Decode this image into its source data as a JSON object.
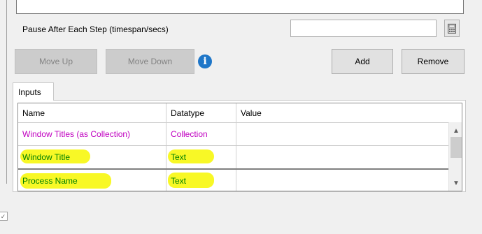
{
  "pause": {
    "label": "Pause After Each Step (timespan/secs)",
    "value": ""
  },
  "buttons": {
    "move_up": "Move Up",
    "move_down": "Move Down",
    "add": "Add",
    "remove": "Remove"
  },
  "tabs": [
    {
      "label": "Inputs",
      "active": true
    }
  ],
  "grid": {
    "columns": [
      "Name",
      "Datatype",
      "Value"
    ],
    "rows": [
      {
        "name": "Window Titles (as Collection)",
        "datatype": "Collection",
        "value": "",
        "color": "#c000c0",
        "highlighted": false
      },
      {
        "name": "Window Title",
        "datatype": "Text",
        "value": "",
        "color": "#008000",
        "highlighted": true
      },
      {
        "name": "Process Name",
        "datatype": "Text",
        "value": "",
        "color": "#008000",
        "highlighted": true
      }
    ]
  },
  "colors": {
    "highlight": "#f7f700",
    "info_icon": "#1e76c8",
    "collection_text": "#c000c0",
    "text_type": "#008000"
  },
  "icons": {
    "info": "i",
    "calculator": "calculator-icon",
    "scroll_up": "▲",
    "scroll_down": "▼"
  }
}
